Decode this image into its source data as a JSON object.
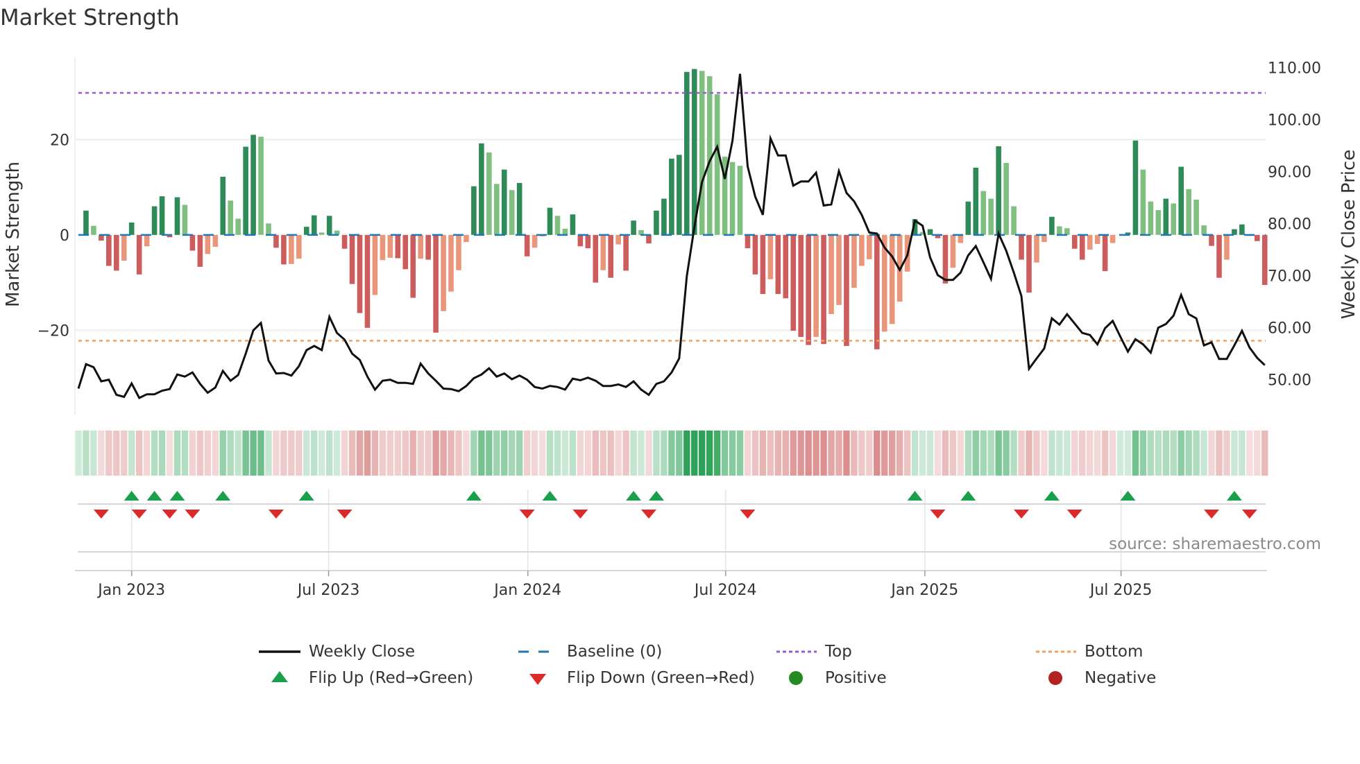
{
  "title": "Market Strength",
  "source": "source: sharemaestro.com",
  "colors": {
    "strong_green": "#2e8b57",
    "weak_green": "#7fbf7f",
    "strong_red": "#cd5c5c",
    "weak_red": "#e9967a",
    "line": "#111111",
    "baseline": "#1f77b4",
    "top": "#9b59d0",
    "bottom": "#f0a060",
    "flip_up": "#1a9f4a",
    "flip_down": "#dc2a2a",
    "positive": "#228b22",
    "negative": "#b22222"
  },
  "chart_data": {
    "type": "bar+line",
    "title": "Market Strength",
    "left_axis": {
      "label": "Market Strength",
      "range": [
        -37.7,
        37.5
      ],
      "ticks": [
        20,
        0,
        -20
      ],
      "tick_labels": [
        "20",
        "0",
        "−20"
      ]
    },
    "right_axis": {
      "label": "Weekly Close Price",
      "range": [
        43.3,
        112.2
      ],
      "ticks": [
        110,
        100,
        90,
        80,
        70,
        60,
        50
      ],
      "tick_labels": [
        "110.00",
        "100.00",
        "90.00",
        "80.00",
        "70.00",
        "60.00",
        "50.00"
      ]
    },
    "x_ticks": [
      {
        "label": "Jan 2023",
        "week": 7
      },
      {
        "label": "Jul 2023",
        "week": 32.9
      },
      {
        "label": "Jan 2024",
        "week": 59.1
      },
      {
        "label": "Jul 2024",
        "week": 85.1
      },
      {
        "label": "Jan 2025",
        "week": 111.3
      },
      {
        "label": "Jul 2025",
        "week": 137.1
      }
    ],
    "top": 29.8,
    "bottom": -22.2,
    "baseline": 0,
    "strength": [
      0,
      5.1,
      1.9,
      -1.2,
      -6.5,
      -7.5,
      -5.4,
      2.6,
      -8.3,
      -2.4,
      6.0,
      8.1,
      -0.5,
      7.9,
      6.3,
      -3.3,
      -6.7,
      -4.0,
      -2.5,
      12.2,
      7.2,
      3.4,
      18.5,
      21.0,
      20.6,
      2.4,
      -2.7,
      -6.2,
      -6.1,
      -5.0,
      1.7,
      4.1,
      0.5,
      4.0,
      0.9,
      -2.9,
      -10.3,
      -16.4,
      -19.5,
      -12.6,
      -5.3,
      -4.8,
      -4.9,
      -7.2,
      -13.2,
      -5.0,
      -5.2,
      -20.5,
      -16,
      -11.9,
      -7.4,
      -1.5,
      10.2,
      19.2,
      17.3,
      10.7,
      13.7,
      9.4,
      10.9,
      -4.5,
      -2.7,
      -0.3,
      5.7,
      4.0,
      1.3,
      4.3,
      -2.4,
      -2.8,
      -10,
      -7.4,
      -9,
      -2,
      -7.5,
      3,
      1,
      -1.8,
      5.1,
      7.6,
      16,
      16.8,
      34.2,
      34.8,
      34.4,
      33.3,
      29.5,
      16.4,
      15.3,
      14.5,
      -2.8,
      -8.3,
      -12.4,
      -9.3,
      -12.4,
      -13.3,
      -20.1,
      -21.4,
      -23.1,
      -21.4,
      -22.9,
      -16.6,
      -14.7,
      -23.3,
      -11.1,
      -6.5,
      -5.1,
      -24,
      -20.3,
      -18.7,
      -14,
      -7.7,
      3.3,
      0.6,
      1.2,
      -0.7,
      -10.2,
      -6.9,
      -1.7,
      7,
      14.1,
      9.2,
      7.6,
      18.6,
      15.1,
      6,
      -5.2,
      -12.1,
      -5.8,
      -1.5,
      3.8,
      1.8,
      1.4,
      -2.9,
      -5.2,
      -3.1,
      -1.9,
      -7.6,
      -1.7,
      0,
      0.5,
      19.8,
      13.7,
      7,
      5.2,
      7.6,
      6.6,
      14.3,
      9.6,
      7.4,
      2,
      -2.3,
      -9,
      -5.2,
      1.2,
      2.2,
      -0.2,
      -1.3,
      -10.5
    ],
    "weekly_close": [
      48.3,
      53,
      52.4,
      49.7,
      50,
      47.1,
      46.7,
      49.3,
      46.5,
      47.2,
      47.2,
      47.9,
      48.2,
      51,
      50.6,
      51.4,
      49.2,
      47.5,
      48.5,
      51.7,
      49.8,
      50.9,
      55,
      59.5,
      60.9,
      53.7,
      51.2,
      51.3,
      50.8,
      52.6,
      55.7,
      56.5,
      55.7,
      62.1,
      59,
      57.7,
      55,
      53.8,
      50.6,
      48.1,
      49.8,
      50,
      49.4,
      49.4,
      49.2,
      53.1,
      51.2,
      49.8,
      48.3,
      48.2,
      47.8,
      48.8,
      50.3,
      51,
      52.2,
      50.6,
      51.2,
      50.1,
      50.8,
      50,
      48.6,
      48.3,
      48.8,
      48.6,
      48.1,
      50.2,
      49.9,
      50.4,
      49.8,
      48.8,
      48.8,
      49.1,
      48.6,
      49.7,
      48.1,
      47.1,
      49.2,
      49.7,
      51.4,
      54.1,
      69.9,
      79.4,
      88,
      92,
      94.8,
      88.6,
      95.9,
      108.8,
      91,
      85.2,
      81.7,
      96.4,
      93.1,
      93.1,
      87.3,
      88.1,
      88.1,
      89.8,
      83.5,
      83.7,
      90.1,
      85.9,
      84.3,
      81.7,
      78.3,
      78.1,
      75.4,
      73.7,
      71.1,
      73.9,
      80.6,
      79.6,
      73.5,
      70.1,
      69.2,
      69.2,
      70.6,
      73.9,
      75.7,
      72.6,
      69.4,
      78.1,
      74.8,
      70.6,
      66.1,
      52.1,
      54.1,
      56,
      61.8,
      60.6,
      62.6,
      60.8,
      59,
      58.6,
      56.8,
      59.9,
      61.3,
      58.3,
      55.4,
      57.8,
      56.8,
      55.2,
      60,
      60.7,
      62.3,
      66.3,
      62.6,
      61.8,
      56.6,
      57.2,
      54,
      54,
      56.6,
      59.4,
      56.2,
      54.2,
      52.8
    ],
    "flip_up_weeks": [
      7,
      10,
      13,
      19,
      30,
      52,
      62,
      73,
      76,
      110,
      117,
      128,
      138,
      152
    ],
    "flip_down_weeks": [
      3,
      8,
      12,
      15,
      26,
      35,
      59,
      66,
      75,
      88,
      113,
      124,
      131,
      149,
      154
    ],
    "legend": [
      {
        "label": "Weekly Close",
        "symbol": "line"
      },
      {
        "label": "Baseline (0)",
        "symbol": "dash"
      },
      {
        "label": "Top",
        "symbol": "dot-purple"
      },
      {
        "label": "Bottom",
        "symbol": "dot-orange"
      },
      {
        "label": "Flip Up (Red→Green)",
        "symbol": "tri-up"
      },
      {
        "label": "Flip Down (Green→Red)",
        "symbol": "tri-down"
      },
      {
        "label": "Positive",
        "symbol": "circle-green"
      },
      {
        "label": "Negative",
        "symbol": "circle-red"
      }
    ]
  }
}
